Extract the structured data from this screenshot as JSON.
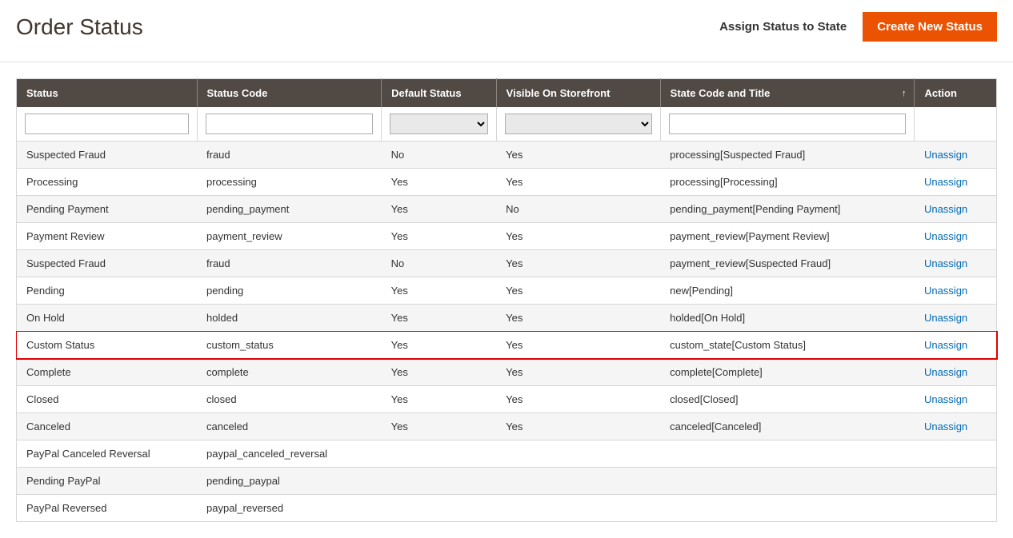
{
  "header": {
    "title": "Order Status",
    "assign_link": "Assign Status to State",
    "create_button": "Create New Status"
  },
  "table": {
    "columns": {
      "status": "Status",
      "code": "Status Code",
      "default": "Default Status",
      "visible": "Visible On Storefront",
      "state": "State Code and Title",
      "action": "Action"
    },
    "filters": {
      "status": "",
      "code": "",
      "default": "",
      "visible": "",
      "state": ""
    },
    "action_label": "Unassign",
    "rows": [
      {
        "status": "Suspected Fraud",
        "code": "fraud",
        "default": "No",
        "visible": "Yes",
        "state": "processing[Suspected Fraud]",
        "has_action": true,
        "highlighted": false
      },
      {
        "status": "Processing",
        "code": "processing",
        "default": "Yes",
        "visible": "Yes",
        "state": "processing[Processing]",
        "has_action": true,
        "highlighted": false
      },
      {
        "status": "Pending Payment",
        "code": "pending_payment",
        "default": "Yes",
        "visible": "No",
        "state": "pending_payment[Pending Payment]",
        "has_action": true,
        "highlighted": false
      },
      {
        "status": "Payment Review",
        "code": "payment_review",
        "default": "Yes",
        "visible": "Yes",
        "state": "payment_review[Payment Review]",
        "has_action": true,
        "highlighted": false
      },
      {
        "status": "Suspected Fraud",
        "code": "fraud",
        "default": "No",
        "visible": "Yes",
        "state": "payment_review[Suspected Fraud]",
        "has_action": true,
        "highlighted": false
      },
      {
        "status": "Pending",
        "code": "pending",
        "default": "Yes",
        "visible": "Yes",
        "state": "new[Pending]",
        "has_action": true,
        "highlighted": false
      },
      {
        "status": "On Hold",
        "code": "holded",
        "default": "Yes",
        "visible": "Yes",
        "state": "holded[On Hold]",
        "has_action": true,
        "highlighted": false
      },
      {
        "status": "Custom Status",
        "code": "custom_status",
        "default": "Yes",
        "visible": "Yes",
        "state": "custom_state[Custom Status]",
        "has_action": true,
        "highlighted": true
      },
      {
        "status": "Complete",
        "code": "complete",
        "default": "Yes",
        "visible": "Yes",
        "state": "complete[Complete]",
        "has_action": true,
        "highlighted": false
      },
      {
        "status": "Closed",
        "code": "closed",
        "default": "Yes",
        "visible": "Yes",
        "state": "closed[Closed]",
        "has_action": true,
        "highlighted": false
      },
      {
        "status": "Canceled",
        "code": "canceled",
        "default": "Yes",
        "visible": "Yes",
        "state": "canceled[Canceled]",
        "has_action": true,
        "highlighted": false
      },
      {
        "status": "PayPal Canceled Reversal",
        "code": "paypal_canceled_reversal",
        "default": "",
        "visible": "",
        "state": "",
        "has_action": false,
        "highlighted": false
      },
      {
        "status": "Pending PayPal",
        "code": "pending_paypal",
        "default": "",
        "visible": "",
        "state": "",
        "has_action": false,
        "highlighted": false
      },
      {
        "status": "PayPal Reversed",
        "code": "paypal_reversed",
        "default": "",
        "visible": "",
        "state": "",
        "has_action": false,
        "highlighted": false
      }
    ]
  }
}
